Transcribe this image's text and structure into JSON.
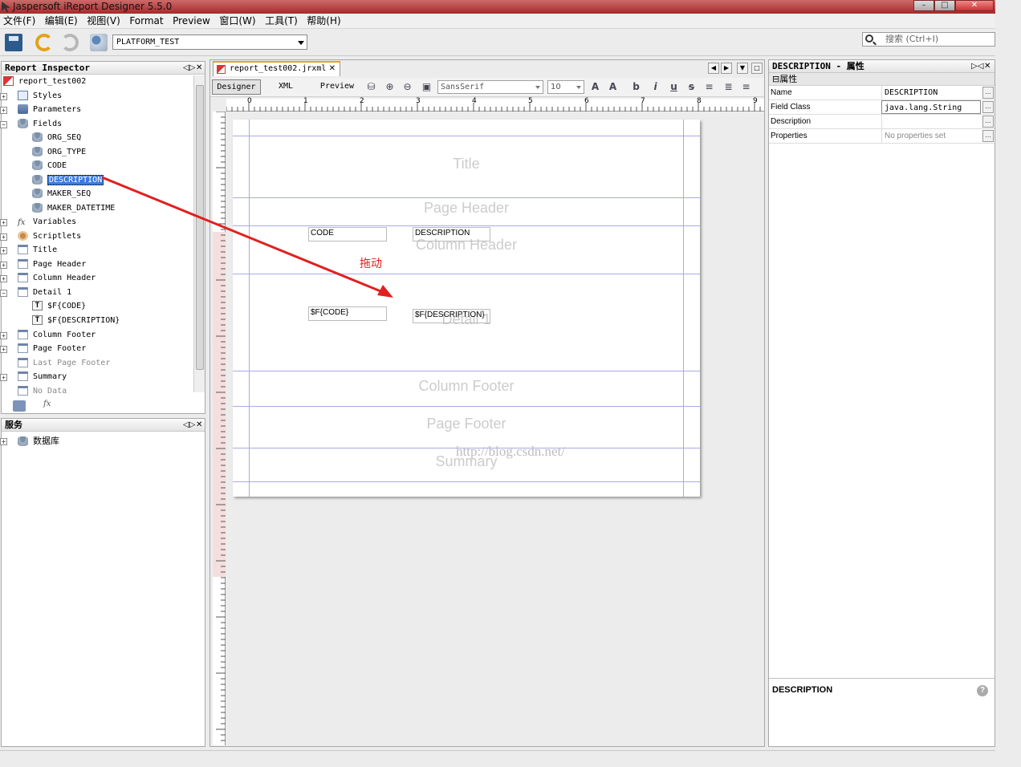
{
  "window": {
    "title": "Jaspersoft iReport Designer 5.5.0"
  },
  "menu": [
    "文件(F)",
    "编辑(E)",
    "视图(V)",
    "Format",
    "Preview",
    "窗口(W)",
    "工具(T)",
    "帮助(H)"
  ],
  "toolbar": {
    "datasource": "PLATFORM_TEST",
    "search_placeholder": "搜索 (Ctrl+I)"
  },
  "inspector": {
    "title": "Report Inspector",
    "root": "report_test002",
    "items": [
      "Styles",
      "Parameters",
      "Fields",
      "Variables",
      "Scriptlets",
      "Title",
      "Page Header",
      "Column Header",
      "Detail 1",
      "Column Footer",
      "Page Footer",
      "Last Page Footer",
      "Summary",
      "No Data"
    ],
    "fields": [
      "ORG_SEQ",
      "ORG_TYPE",
      "CODE",
      "DESCRIPTION",
      "MAKER_SEQ",
      "MAKER_DATETIME"
    ],
    "detail_children": [
      "$F{CODE}",
      "$F{DESCRIPTION}"
    ]
  },
  "services": {
    "title": "服务",
    "items": [
      "数据库"
    ]
  },
  "editor": {
    "tab": "report_test002.jrxml",
    "views": [
      "Designer",
      "XML",
      "Preview"
    ],
    "font": "SansSerif",
    "size": "10",
    "ruler_h": [
      "0",
      "1",
      "2",
      "3",
      "4",
      "5",
      "6",
      "7",
      "8",
      "9"
    ],
    "bands": [
      "Title",
      "Page Header",
      "Column Header",
      "Detail 1",
      "Column Footer",
      "Page Footer",
      "Summary"
    ],
    "column_header_fields": [
      "CODE",
      "DESCRIPTION"
    ],
    "detail_fields": [
      "$F{CODE}",
      "$F{DESCRIPTION}"
    ],
    "drag_label": "拖动",
    "watermark": "http://blog.csdn.net/"
  },
  "properties": {
    "title": "DESCRIPTION - 属性",
    "section": "属性",
    "rows": [
      {
        "key": "Name",
        "value": "DESCRIPTION"
      },
      {
        "key": "Field Class",
        "value": "java.lang.String"
      },
      {
        "key": "Description",
        "value": ""
      },
      {
        "key": "Properties",
        "value": "No properties set"
      }
    ],
    "footer_title": "DESCRIPTION"
  },
  "colors": {
    "accent": "#3a7cd9",
    "arrow": "#e02020",
    "band_line": "#a9a9e8"
  }
}
